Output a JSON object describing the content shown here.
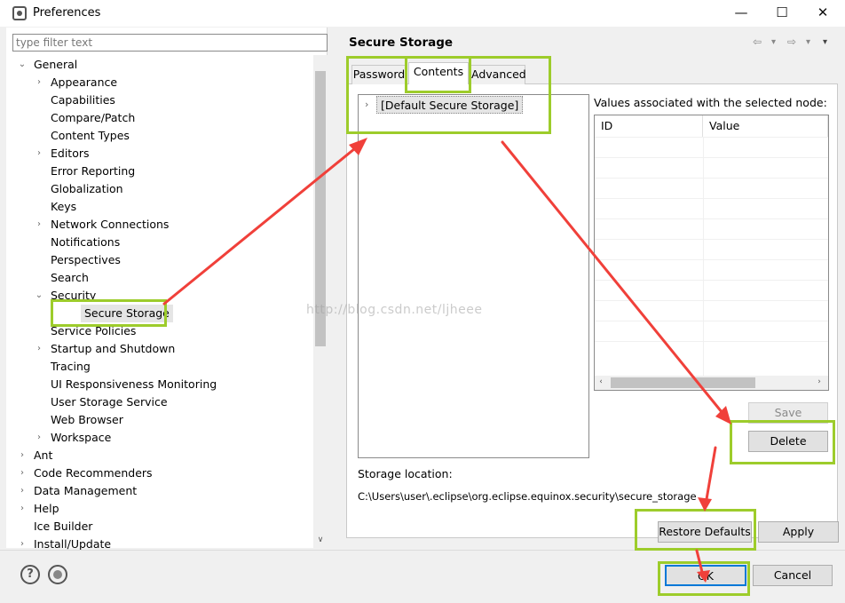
{
  "window": {
    "title": "Preferences",
    "controls": {
      "minimize": "—",
      "maximize": "☐",
      "close": "✕"
    }
  },
  "filter": {
    "placeholder": "type filter text"
  },
  "tree": [
    {
      "label": "General",
      "arrow": "⌄",
      "level": 0
    },
    {
      "label": "Appearance",
      "arrow": "›",
      "level": 1
    },
    {
      "label": "Capabilities",
      "arrow": "",
      "level": 1
    },
    {
      "label": "Compare/Patch",
      "arrow": "",
      "level": 1
    },
    {
      "label": "Content Types",
      "arrow": "",
      "level": 1
    },
    {
      "label": "Editors",
      "arrow": "›",
      "level": 1
    },
    {
      "label": "Error Reporting",
      "arrow": "",
      "level": 1
    },
    {
      "label": "Globalization",
      "arrow": "",
      "level": 1
    },
    {
      "label": "Keys",
      "arrow": "",
      "level": 1
    },
    {
      "label": "Network Connections",
      "arrow": "›",
      "level": 1
    },
    {
      "label": "Notifications",
      "arrow": "",
      "level": 1
    },
    {
      "label": "Perspectives",
      "arrow": "",
      "level": 1
    },
    {
      "label": "Search",
      "arrow": "",
      "level": 1
    },
    {
      "label": "Security",
      "arrow": "⌄",
      "level": 1
    },
    {
      "label": "Secure Storage",
      "arrow": "",
      "level": 2,
      "selected": true
    },
    {
      "label": "Service Policies",
      "arrow": "",
      "level": 1
    },
    {
      "label": "Startup and Shutdown",
      "arrow": "›",
      "level": 1
    },
    {
      "label": "Tracing",
      "arrow": "",
      "level": 1
    },
    {
      "label": "UI Responsiveness Monitoring",
      "arrow": "",
      "level": 1
    },
    {
      "label": "User Storage Service",
      "arrow": "",
      "level": 1
    },
    {
      "label": "Web Browser",
      "arrow": "",
      "level": 1
    },
    {
      "label": "Workspace",
      "arrow": "›",
      "level": 1
    },
    {
      "label": "Ant",
      "arrow": "›",
      "level": 0
    },
    {
      "label": "Code Recommenders",
      "arrow": "›",
      "level": 0
    },
    {
      "label": "Data Management",
      "arrow": "›",
      "level": 0
    },
    {
      "label": "Help",
      "arrow": "›",
      "level": 0
    },
    {
      "label": "Ice Builder",
      "arrow": "",
      "level": 0
    },
    {
      "label": "Install/Update",
      "arrow": "›",
      "level": 0
    }
  ],
  "page": {
    "title": "Secure Storage",
    "nav": {
      "back": "⇦",
      "back_menu": "▾",
      "forward": "⇨",
      "forward_menu": "▾",
      "view_menu": "▾"
    },
    "tabs": [
      {
        "label": "Password"
      },
      {
        "label": "Contents",
        "active": true
      },
      {
        "label": "Advanced"
      }
    ],
    "node_arrow": "›",
    "node": "[Default Secure Storage]",
    "values_label": "Values associated with the selected node:",
    "table": {
      "columns": [
        "ID",
        "Value"
      ]
    },
    "save_label": "Save",
    "delete_label": "Delete",
    "storage_location_label": "Storage location:",
    "storage_location_value": "C:\\Users\\user\\.eclipse\\org.eclipse.equinox.security\\secure_storage",
    "restore_defaults_label": "Restore Defaults",
    "apply_label": "Apply"
  },
  "footer": {
    "help_icon": "?",
    "ok_label": "OK",
    "cancel_label": "Cancel"
  },
  "watermark": "http://blog.csdn.net/ljheee",
  "colors": {
    "highlight": "#9dcc2b",
    "arrow": "#f0403a",
    "focus": "#0078d7"
  }
}
